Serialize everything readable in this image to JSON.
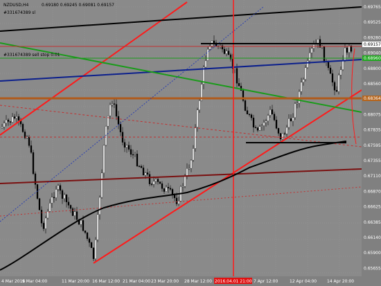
{
  "header": {
    "symbol": "NZDUSD,H4",
    "ohlc": "0.69180 0.69245 0.69081 0.69157",
    "order_label_1": "#331674389 sl",
    "order_label_2": "#331674389 sell stop 0.01"
  },
  "price_axis": {
    "labels": [
      "0.69765",
      "0.69525",
      "0.69280",
      "0.69040",
      "0.68800",
      "0.68560",
      "0.68320",
      "0.68075",
      "0.67835",
      "0.67595",
      "0.67355",
      "0.67110",
      "0.66870",
      "0.66625",
      "0.66385",
      "0.66140",
      "0.65900",
      "0.65655"
    ],
    "badge_current": "0.69157",
    "badge_current_color": "#ffffff",
    "badge_green": "0.68960",
    "badge_green_color": "#22a822",
    "badge_brown": "0.68364",
    "badge_brown_color": "#b5651d"
  },
  "time_axis": {
    "labels": [
      "4 Mar 2016",
      "9 Mar 04:00",
      "11 Mar 20:00",
      "16 Mar 12:00",
      "21 Mar 04:00",
      "23 Mar 20:00",
      "28 Mar 12:00",
      "2016.04.01 21:00",
      "7 Apr 12:00",
      "12 Apr 04:00",
      "14 Apr 20:00"
    ],
    "highlight_label": "2016.04.01 21:00",
    "highlight_color": "#e01010"
  },
  "colors": {
    "background": "#8a8a8a",
    "candle_up": "#ffffff",
    "candle_down": "#000000",
    "trendline_red": "#ff1a1a",
    "trendline_black": "#000000",
    "trendline_blue": "#0b1f8c",
    "trendline_green": "#1a9b1a",
    "trendline_brown": "#b05a1a",
    "trendline_darkred": "#7a1010"
  }
}
